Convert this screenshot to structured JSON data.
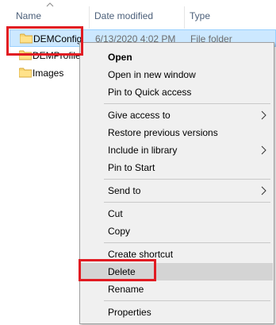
{
  "header": {
    "name_label": "Name",
    "date_label": "Date modified",
    "type_label": "Type"
  },
  "files": [
    {
      "name": "DEMConfig",
      "date": "6/13/2020 4:02 PM",
      "type": "File folder"
    },
    {
      "name": "DEMProfile",
      "date": "",
      "type": ""
    },
    {
      "name": "Images",
      "date": "",
      "type": ""
    }
  ],
  "context_menu": {
    "items": [
      {
        "label": "Open",
        "bold": true
      },
      {
        "label": "Open in new window"
      },
      {
        "label": "Pin to Quick access"
      },
      {
        "label": "Give access to",
        "submenu": true
      },
      {
        "label": "Restore previous versions"
      },
      {
        "label": "Include in library",
        "submenu": true
      },
      {
        "label": "Pin to Start"
      },
      {
        "label": "Send to",
        "submenu": true
      },
      {
        "label": "Cut"
      },
      {
        "label": "Copy"
      },
      {
        "label": "Create shortcut"
      },
      {
        "label": "Delete",
        "highlighted": true
      },
      {
        "label": "Rename"
      },
      {
        "label": "Properties"
      }
    ]
  },
  "colors": {
    "selection": "#cce8ff",
    "menu_highlight": "#d4d4d4",
    "annotation": "#e11b22",
    "folder": "#f8d775"
  }
}
